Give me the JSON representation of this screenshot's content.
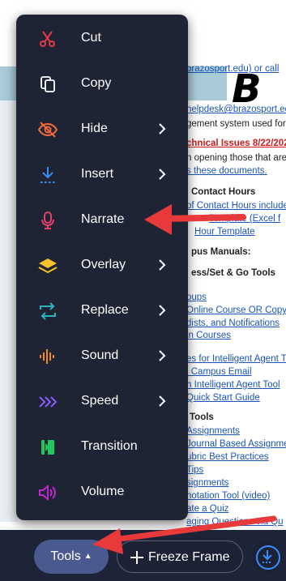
{
  "document": {
    "logo_text": "B",
    "lines": [
      "brazosport.edu) or call",
      "helpdesk@brazosport.ed",
      "gement system used for",
      "chnical Issues 8/22/2022",
      "n opening those that are",
      "s these documents.",
      "Contact Hours",
      "of Contact Hours include",
      "Template (Excel f",
      "Hour Template",
      "pus Manuals:",
      "ess/Set & Go Tools",
      "oups",
      "Online Course OR Copyi",
      "dists, and Notifications",
      "in Courses",
      "es for Intelligent Agent To",
      "l Campus Email",
      "h Intelligent Agent Tool",
      "Quick Start Guide",
      "Tools",
      "Assignments",
      "Journal Based Assignme",
      "ubric Best Practices",
      "Tips",
      "signments",
      "notation Tool (video)",
      "ate a Quiz",
      "aging Questions via Qu"
    ]
  },
  "menu": {
    "items": [
      {
        "label": "Cut",
        "icon": "scissors-icon",
        "color": "#e53946",
        "has_submenu": false
      },
      {
        "label": "Copy",
        "icon": "copy-icon",
        "color": "#ffffff",
        "has_submenu": false
      },
      {
        "label": "Hide",
        "icon": "eye-slash-icon",
        "color": "#f26a3c",
        "has_submenu": true
      },
      {
        "label": "Insert",
        "icon": "insert-download-icon",
        "color": "#3b8df0",
        "has_submenu": true
      },
      {
        "label": "Narrate",
        "icon": "microphone-icon",
        "color": "#e8406d",
        "has_submenu": false
      },
      {
        "label": "Overlay",
        "icon": "layers-icon",
        "color": "#f6c22a",
        "has_submenu": true
      },
      {
        "label": "Replace",
        "icon": "replace-swap-icon",
        "color": "#2bb3c0",
        "has_submenu": true
      },
      {
        "label": "Sound",
        "icon": "sound-wave-icon",
        "color": "#f28a1f",
        "has_submenu": true
      },
      {
        "label": "Speed",
        "icon": "speed-chevrons-icon",
        "color": "#8b5cf6",
        "has_submenu": true
      },
      {
        "label": "Transition",
        "icon": "transition-icon",
        "color": "#22c55e",
        "has_submenu": false
      },
      {
        "label": "Volume",
        "icon": "volume-icon",
        "color": "#c026d3",
        "has_submenu": false
      }
    ]
  },
  "toolbar": {
    "tools_label": "Tools",
    "freeze_label": "Freeze Frame",
    "download_icon": "download-icon",
    "accent": "#3a8cff"
  },
  "annotation_color": "#e8393b"
}
